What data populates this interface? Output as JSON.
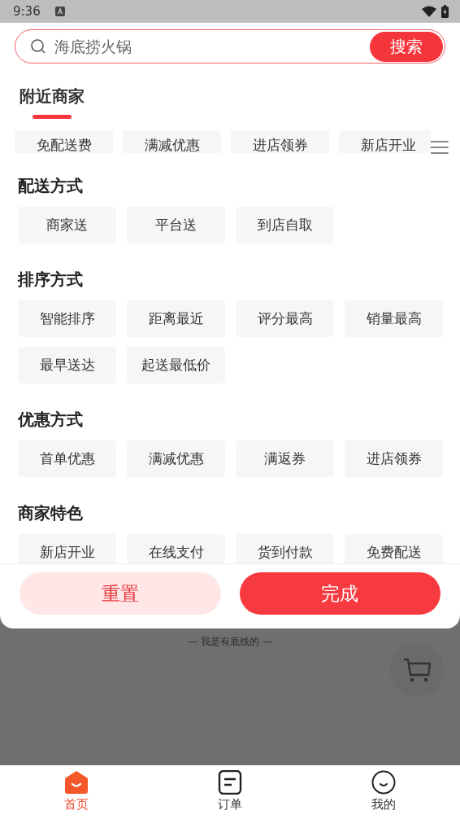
{
  "status_bar": {
    "time": "9:36"
  },
  "search": {
    "placeholder": "海底捞火锅",
    "button": "搜索"
  },
  "tabs": [
    {
      "label": "附近商家",
      "selected": true
    }
  ],
  "quick_filters": [
    {
      "label": "免配送费",
      "selected": false
    },
    {
      "label": "满减优惠",
      "selected": false
    },
    {
      "label": "进店领券",
      "selected": false
    },
    {
      "label": "新店开业",
      "selected": false
    }
  ],
  "sections": [
    {
      "title": "配送方式",
      "options": [
        {
          "label": "商家送",
          "selected": false
        },
        {
          "label": "平台送",
          "selected": false
        },
        {
          "label": "到店自取",
          "selected": false
        }
      ]
    },
    {
      "title": "排序方式",
      "options": [
        {
          "label": "智能排序",
          "selected": false
        },
        {
          "label": "距离最近",
          "selected": false
        },
        {
          "label": "评分最高",
          "selected": false
        },
        {
          "label": "销量最高",
          "selected": false
        },
        {
          "label": "最早送达",
          "selected": false
        },
        {
          "label": "起送最低价",
          "selected": false
        }
      ]
    },
    {
      "title": "优惠方式",
      "options": [
        {
          "label": "首单优惠",
          "selected": false
        },
        {
          "label": "满减优惠",
          "selected": false
        },
        {
          "label": "满返券",
          "selected": false
        },
        {
          "label": "进店领券",
          "selected": false
        }
      ]
    },
    {
      "title": "商家特色",
      "options": [
        {
          "label": "新店开业",
          "selected": false
        },
        {
          "label": "在线支付",
          "selected": false
        },
        {
          "label": "货到付款",
          "selected": false
        },
        {
          "label": "免费配送",
          "selected": false
        }
      ]
    }
  ],
  "actions": {
    "reset": "重置",
    "done": "完成"
  },
  "footer_note": "— 我是有底线的 —",
  "nav": [
    {
      "label": "首页",
      "kind": "home",
      "selected": true
    },
    {
      "label": "订单",
      "kind": "orders",
      "selected": false
    },
    {
      "label": "我的",
      "kind": "profile",
      "selected": false
    }
  ]
}
